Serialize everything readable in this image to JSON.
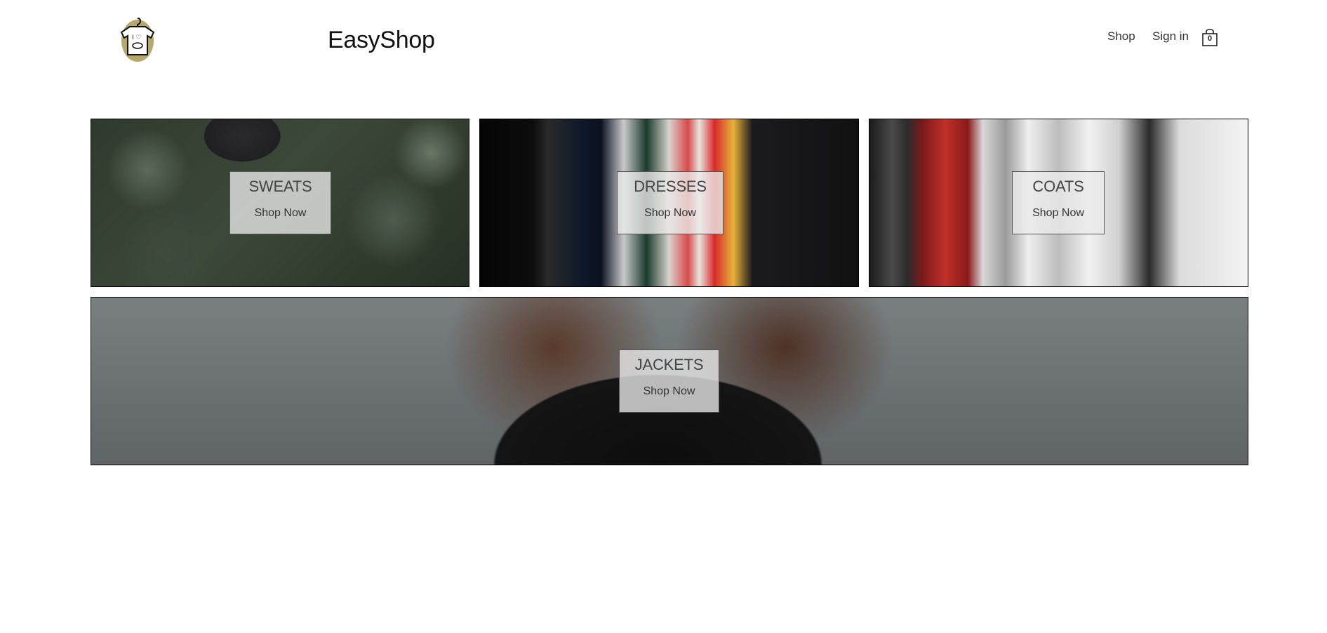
{
  "header": {
    "brand": "EasyShop",
    "nav": {
      "shop": "Shop",
      "sign_in": "Sign in"
    },
    "cart_count": "0",
    "logo_icon": "shirt-hanger-logo-icon",
    "cart_icon": "shopping-bag-icon"
  },
  "categories": [
    {
      "title": "SWEATS",
      "cta": "Shop Now"
    },
    {
      "title": "DRESSES",
      "cta": "Shop Now"
    },
    {
      "title": "COATS",
      "cta": "Shop Now"
    },
    {
      "title": "JACKETS",
      "cta": "Shop Now"
    }
  ],
  "colors": {
    "background": "#ffffff",
    "text": "#222222",
    "logo_accent": "#b5a86a"
  }
}
